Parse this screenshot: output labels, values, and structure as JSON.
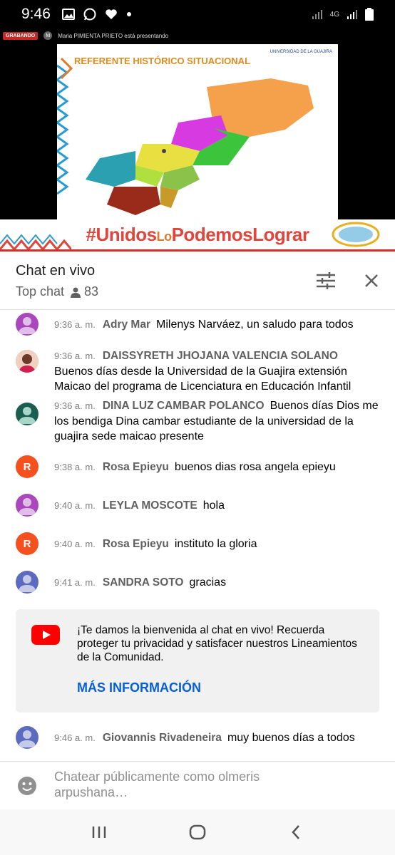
{
  "status": {
    "time": "9:46",
    "network": "4G"
  },
  "video": {
    "recording_label": "GRABANDO",
    "presenter_initial": "M",
    "presenter_text": "Maria PIMIENTA PRIETO está presentando",
    "slide_title": "REFERENTE HISTÓRICO SITUACIONAL",
    "logo_text": "UNIVERSIDAD DE LA GUAJIRA",
    "banner_part1": "#Unidos",
    "banner_part2": "Lo",
    "banner_part3": "PodemosLograr"
  },
  "chat": {
    "title": "Chat en vivo",
    "mode": "Top chat",
    "viewer_count": "83"
  },
  "messages": [
    {
      "time": "9:36 a. m.",
      "author": "Adry Mar",
      "text": "Milenys Narváez, un saludo para todos",
      "avatar_color": "#ab47bc",
      "initial": ""
    },
    {
      "time": "9:36 a. m.",
      "author": "DAISSYRETH JHOJANA VALENCIA SOLANO",
      "text": "Buenos días desde la Universidad de la Guajira extensión Maicao del programa de Licenciatura en Educación Infantil",
      "avatar_color": "#c98a6a",
      "initial": ""
    },
    {
      "time": "9:36 a. m.",
      "author": "DINA LUZ CAMBAR POLANCO",
      "text": "Buenos días Dios me los bendiga Dina cambar estudiante de la universidad de la guajira sede maicao presente",
      "avatar_color": "#1b5e4f",
      "initial": ""
    },
    {
      "time": "9:38 a. m.",
      "author": "Rosa Epieyu",
      "text": "buenos dias rosa angela epieyu",
      "avatar_color": "#f4511e",
      "initial": "R"
    },
    {
      "time": "9:40 a. m.",
      "author": "LEYLA MOSCOTE",
      "text": "hola",
      "avatar_color": "#ab47bc",
      "initial": ""
    },
    {
      "time": "9:40 a. m.",
      "author": "Rosa Epieyu",
      "text": "instituto la gloria",
      "avatar_color": "#f4511e",
      "initial": "R"
    },
    {
      "time": "9:41 a. m.",
      "author": "SANDRA SOTO",
      "text": "gracias",
      "avatar_color": "#5c6bc0",
      "initial": ""
    },
    {
      "time": "9:46 a. m.",
      "author": "Giovannis Rivadeneira",
      "text": "muy buenos días a todos",
      "avatar_color": "#5c6bc0",
      "initial": ""
    }
  ],
  "welcome": {
    "text": "¡Te damos la bienvenida al chat en vivo! Recuerda proteger tu privacidad y satisfacer nuestros Lineamientos de la Comunidad.",
    "link": "MÁS INFORMACIÓN"
  },
  "input": {
    "placeholder": "Chatear públicamente como olmeris arpushana…"
  },
  "colors": {
    "accent_red": "#d32f2f",
    "link_blue": "#065fd4",
    "youtube_red": "#ff0000"
  }
}
